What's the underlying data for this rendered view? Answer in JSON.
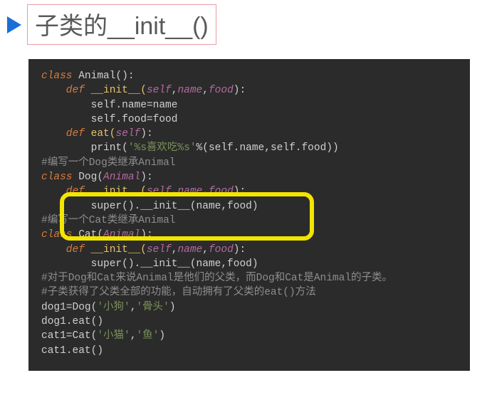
{
  "title": "子类的__init__()",
  "code": {
    "l01": {
      "p1": "class",
      "p2": " Animal():"
    },
    "l02": {
      "p1": "    def",
      "p2": " __init__(",
      "p3": "self",
      "p4": ",",
      "p5": "name",
      "p6": ",",
      "p7": "food",
      "p8": "):"
    },
    "l03": "        self.name=name",
    "l04": "        self.food=food",
    "l05": "",
    "l06": {
      "p1": "    def",
      "p2": " eat(",
      "p3": "self",
      "p4": "):"
    },
    "l07": {
      "p1": "        print(",
      "p2": "'%s喜欢吃%s'",
      "p3": "%(self.name,self.food))"
    },
    "l08": "",
    "l09": "#编写一个Dog类继承Animal",
    "l10": {
      "p1": "class",
      "p2": " Dog(",
      "p3": "Animal",
      "p4": "):"
    },
    "l11": {
      "p1": "    def",
      "p2": " __init__(",
      "p3": "self",
      "p4": ",",
      "p5": "name",
      "p6": ",",
      "p7": "food",
      "p8": "):"
    },
    "l12": "        super().__init__(name,food)",
    "l13": "#编写一个Cat类继承Animal",
    "l14": {
      "p1": "class",
      "p2": " Cat(",
      "p3": "Animal",
      "p4": "):"
    },
    "l15": {
      "p1": "    def",
      "p2": " __init__(",
      "p3": "self",
      "p4": ",",
      "p5": "name",
      "p6": ",",
      "p7": "food",
      "p8": "):"
    },
    "l16": "        super().__init__(name,food)",
    "l17": "#对于Dog和Cat来说Animal是他们的父类，而Dog和Cat是Animal的子类。",
    "l18": "#子类获得了父类全部的功能，自动拥有了父类的eat()方法",
    "l19": {
      "p1": "dog1=Dog(",
      "p2": "'小狗'",
      "p3": ",",
      "p4": "'骨头'",
      "p5": ")"
    },
    "l20": "dog1.eat()",
    "l21": {
      "p1": "cat1=Cat(",
      "p2": "'小猫'",
      "p3": ",",
      "p4": "'鱼'",
      "p5": ")"
    },
    "l22": "cat1.eat()"
  }
}
